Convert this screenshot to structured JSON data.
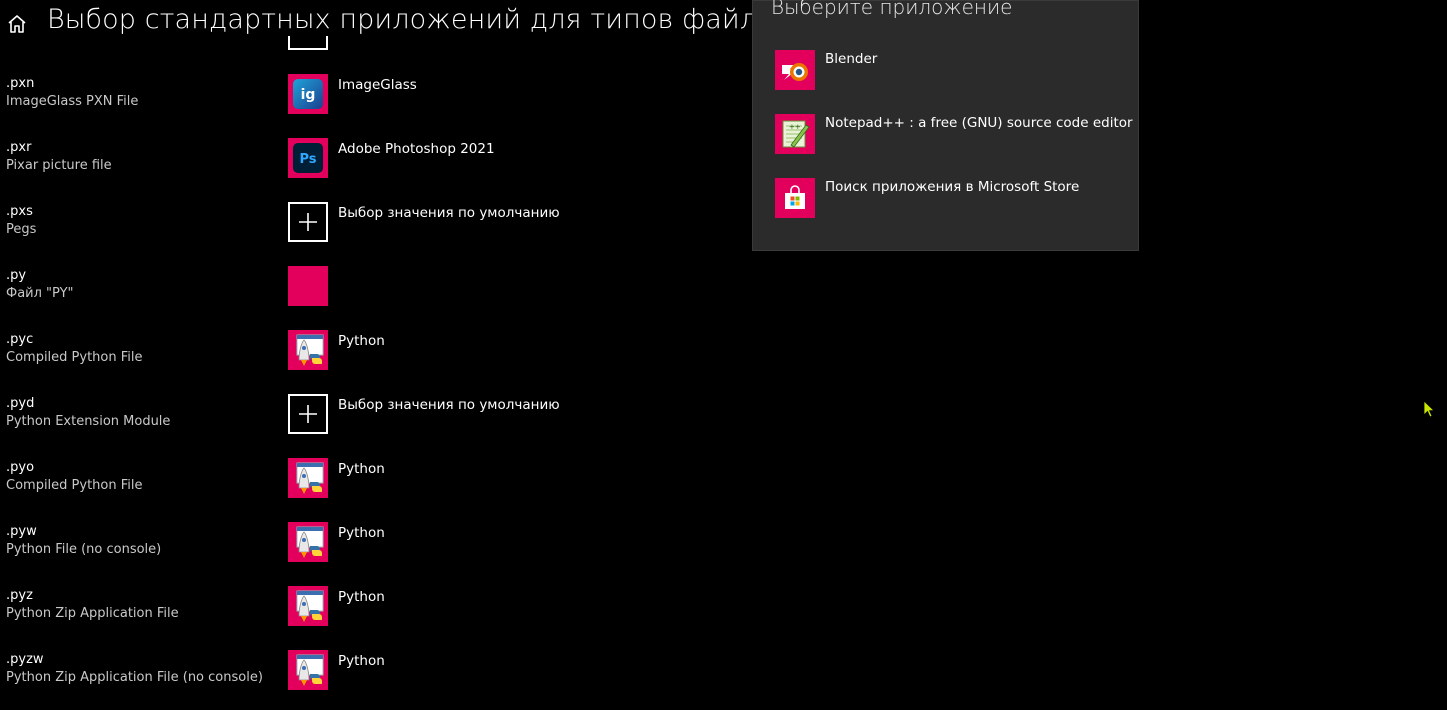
{
  "header": {
    "title": "Выбор стандартных приложений для типов файлов"
  },
  "rows": [
    {
      "ext": ".pxn",
      "desc": "ImageGlass PXN File",
      "app": "ImageGlass",
      "icon": "imageglass-icon"
    },
    {
      "ext": ".pxr",
      "desc": "Pixar picture file",
      "app": "Adobe Photoshop 2021",
      "icon": "photoshop-icon"
    },
    {
      "ext": ".pxs",
      "desc": "Pegs",
      "app": "Выбор значения по умолчанию",
      "icon": "plus-icon"
    },
    {
      "ext": ".py",
      "desc": "Файл \"PY\"",
      "app": "",
      "icon": "blank-app-icon"
    },
    {
      "ext": ".pyc",
      "desc": "Compiled Python File",
      "app": "Python",
      "icon": "python-launcher-icon"
    },
    {
      "ext": ".pyd",
      "desc": "Python Extension Module",
      "app": "Выбор значения по умолчанию",
      "icon": "plus-icon"
    },
    {
      "ext": ".pyo",
      "desc": "Compiled Python File",
      "app": "Python",
      "icon": "python-launcher-icon"
    },
    {
      "ext": ".pyw",
      "desc": "Python File (no console)",
      "app": "Python",
      "icon": "python-launcher-icon"
    },
    {
      "ext": ".pyz",
      "desc": "Python Zip Application File",
      "app": "Python",
      "icon": "python-launcher-icon"
    },
    {
      "ext": ".pyzw",
      "desc": "Python Zip Application File (no console)",
      "app": "Python",
      "icon": "python-launcher-icon"
    }
  ],
  "popup": {
    "title": "Выберите приложение",
    "options": [
      {
        "label": "Blender",
        "icon": "blender-icon"
      },
      {
        "label": "Notepad++ : a free (GNU) source code editor",
        "icon": "notepad-plus-plus-icon"
      },
      {
        "label": "Поиск приложения в Microsoft Store",
        "icon": "microsoft-store-icon"
      }
    ]
  },
  "colors": {
    "accent": "#e3005c",
    "background": "#000000",
    "popup_bg": "#2b2b2b",
    "cursor": "#c8e600"
  }
}
